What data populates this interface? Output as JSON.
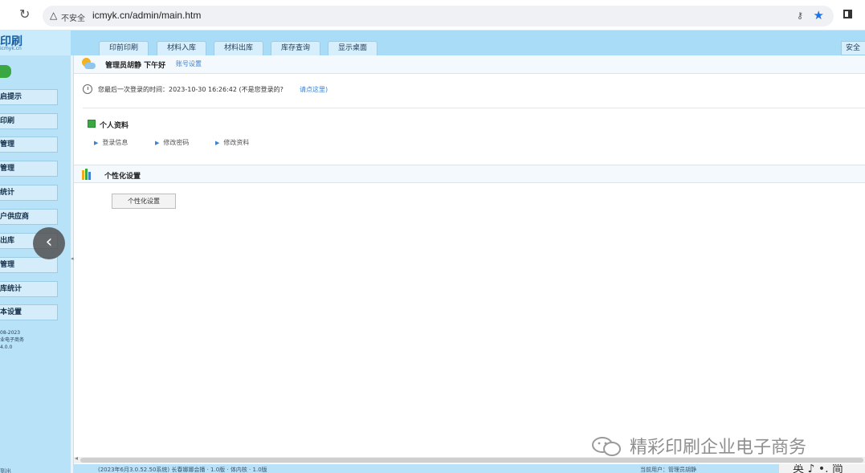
{
  "browser": {
    "security_label": "不安全",
    "url": "icmyk.cn/admin/main.htm"
  },
  "brand": {
    "logo_text": "印刷",
    "logo_sub": "icmyk.cn"
  },
  "top_tabs": [
    "印前印刷",
    "材料入库",
    "材料出库",
    "库存查询",
    "显示桌面"
  ],
  "top_right_label": "安全",
  "sidebar": {
    "items": [
      "启提示",
      "印刷",
      "管理",
      "管理",
      "统计",
      "户供应商",
      "出库",
      "管理",
      "库统计",
      "本设置"
    ],
    "footer": [
      "08-2023",
      "业电子商务",
      "4.0.0"
    ],
    "bottom": "到出"
  },
  "greeting": {
    "text": "管理员胡静 下午好",
    "link": "账号设置"
  },
  "login_info": {
    "text": "您最后一次登录的时间：2023-10-30 16:26:42 (不是您登录的?",
    "link": "请点这里)"
  },
  "profile": {
    "title": "个人资料",
    "links": [
      "登录信息",
      "修改密码",
      "修改资料"
    ]
  },
  "personalization": {
    "title": "个性化设置",
    "button": "个性化设置"
  },
  "status_bar": {
    "left": "(2023年6月3.0.52.50系统) 长春娜娜会播 · 1.0版 · 体内核 · 1.0版",
    "right": "当前用户：管理员胡静"
  },
  "ime": "英 ♪ •. 简",
  "watermark": "精彩印刷企业电子商务",
  "colors": {
    "topbar": "#a9dcf7",
    "sidebar": "#b8e2f8",
    "link": "#3d7fd0"
  }
}
